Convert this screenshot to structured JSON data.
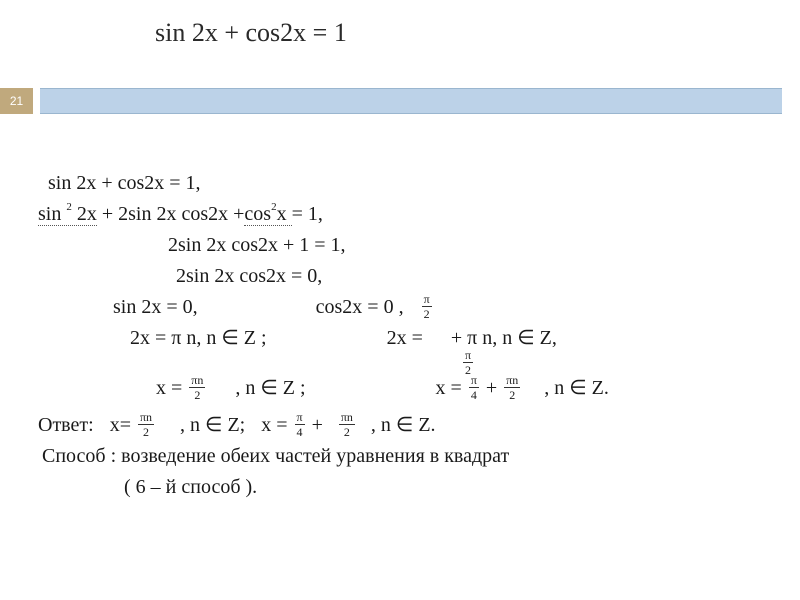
{
  "slide_number": "21",
  "title": "sin 2x + cos2x = 1",
  "lines": {
    "l1": "sin 2x + cos2x = 1,",
    "l2a": "sin ",
    "l2sup1": "2",
    "l2b": " 2x",
    "l2c": " + 2sin 2x cos2x +",
    "l2d": "cos",
    "l2sup2": "2",
    "l2e": "x ",
    "l2f": "= 1,",
    "l3": "2sin 2x cos2x + 1 =  1,",
    "l4": "2sin 2x cos2x = 0,",
    "l5a": "sin 2x = 0,",
    "l5b": "cos2x = 0 ,",
    "l6a": "2x = π n, n ∈  Z ;",
    "l6b": "2x =",
    "l6c": "+ π n, n ∈  Z,",
    "l7a": "x =",
    "l7b": ", n ∈  Z ;",
    "l7c": "x =",
    "l7d": "+",
    "l7e": ", n ∈  Z.",
    "ans_label": "Ответ:",
    "ans_a": "x=",
    "ans_b": ", n ∈  Z;",
    "ans_c": "x =",
    "ans_d": "+",
    "ans_e": ", n ∈  Z.",
    "method1": "Способ : возведение обеих частей уравнения в квадрат",
    "method2": "( 6 – й способ ).",
    "frac": {
      "pi2_num": "π",
      "pi2_den": "2",
      "pi4_num": "π",
      "pi4_den": "4",
      "pin2_num": "πn",
      "pin2_den": "2"
    }
  }
}
